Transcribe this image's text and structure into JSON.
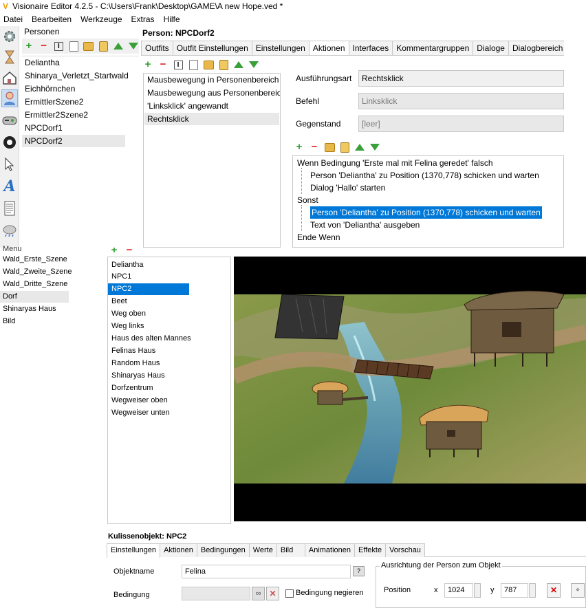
{
  "window": {
    "title": "Visionaire Editor 4.2.5 - C:\\Users\\Frank\\Desktop\\GAME\\A new Hope.ved *"
  },
  "menu": [
    "Datei",
    "Bearbeiten",
    "Werkzeuge",
    "Extras",
    "Hilfe"
  ],
  "left_tools": [
    "settings-icon",
    "hourglass-icon",
    "house-icon",
    "person-icon",
    "gamepad-icon",
    "ball-icon",
    "cursor-icon",
    "font-icon",
    "text-document-icon",
    "weather-icon"
  ],
  "persons_panel": {
    "title": "Personen",
    "items": [
      "Deliantha",
      "Shinarya_Verletzt_Startwald",
      "Eichhörnchen",
      "ErmittlerSzene2",
      "Ermittler2Szene2",
      "NPCDorf1",
      "NPCDorf2"
    ],
    "selected": 6
  },
  "person_detail": {
    "title": "Person: NPCDorf2",
    "tabs": [
      "Outfits",
      "Outfit Einstellungen",
      "Einstellungen",
      "Aktionen",
      "Interfaces",
      "Kommentargruppen",
      "Dialoge",
      "Dialogbereich"
    ],
    "active_tab": 3,
    "actions": [
      "Mausbewegung in Personenbereich",
      "Mausbewegung aus Personenbereich",
      "'Linksklick' angewandt",
      "Rechtsklick"
    ],
    "selected_action": 3,
    "ausfuehrungsart": {
      "label": "Ausführungsart",
      "value": "Rechtsklick"
    },
    "befehl": {
      "label": "Befehl",
      "value": "Linksklick"
    },
    "gegenstand": {
      "label": "Gegenstand",
      "value": "[leer]"
    },
    "action_parts": [
      {
        "text": "Wenn Bedingung 'Erste mal mit Felina geredet' falsch",
        "indent": 0
      },
      {
        "text": "Person 'Deliantha' zu Position (1370,778) schicken und warten",
        "indent": 1
      },
      {
        "text": "Dialog 'Hallo' starten",
        "indent": 1
      },
      {
        "text": "Sonst",
        "indent": 0
      },
      {
        "text": "Person 'Deliantha' zu Position (1370,778) schicken und warten",
        "indent": 1
      },
      {
        "text": "Text von 'Deliantha' ausgeben",
        "indent": 1
      },
      {
        "text": "Ende Wenn",
        "indent": 0
      }
    ],
    "selected_part": 4
  },
  "scenes_panel": {
    "partial_label": "Menu",
    "items": [
      "Wald_Erste_Szene",
      "Wald_Zweite_Szene",
      "Wald_Dritte_Szene",
      "Dorf",
      "Shinaryas Haus",
      "Bild"
    ],
    "selected": 3
  },
  "objects_panel": {
    "items": [
      "Deliantha",
      "NPC1",
      "NPC2",
      "Beet",
      "Weg oben",
      "Weg links",
      "Haus des alten Mannes",
      "Felinas Haus",
      "Random Haus",
      "Shinaryas Haus",
      "Dorfzentrum",
      "Wegweiser oben",
      "Wegweiser unten"
    ],
    "selected": 2
  },
  "scene_object": {
    "title": "Kulissenobjekt: NPC2",
    "tabs": [
      "Einstellungen",
      "Aktionen",
      "Bedingungen",
      "Werte",
      "Bild",
      "Animationen",
      "Effekte",
      "Vorschau"
    ],
    "active_tab": 0,
    "objektname_label": "Objektname",
    "objektname_value": "Felina",
    "bedingung_label": "Bedingung",
    "negate_label": "Bedingung negieren",
    "orientation_group": "Ausrichtung der Person zum Objekt",
    "position_label": "Position",
    "x_label": "x",
    "x_value": "1024",
    "y_label": "y",
    "y_value": "787"
  },
  "colors": {
    "selection": "#0078d7",
    "list_selected": "#e8e8e8"
  }
}
